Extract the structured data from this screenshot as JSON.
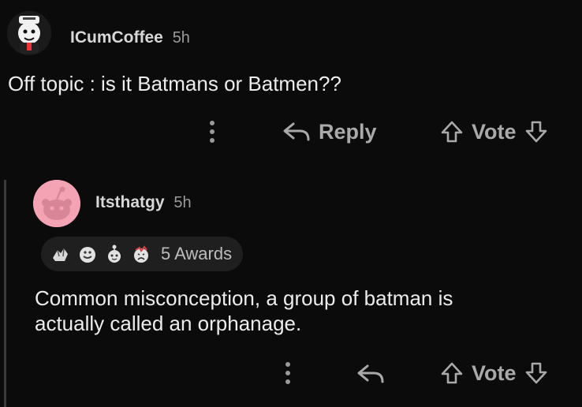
{
  "comment": {
    "author": "ICumCoffee",
    "time": "5h",
    "text": "Off topic : is it Batmans or Batmen??",
    "actions": {
      "reply_label": "Reply",
      "vote_label": "Vote"
    }
  },
  "reply": {
    "author": "Itsthatgy",
    "time": "5h",
    "awards_label": "5 Awards",
    "text_line1": "Common misconception, a group of batman is",
    "text_line2": "actually called an orphanage.",
    "actions": {
      "vote_label": "Vote"
    }
  },
  "colors": {
    "background": "#0b0b0b",
    "reply_avatar": "#f4a3b4",
    "muted": "#a9a9a9"
  },
  "icons": [
    "avatar",
    "more-icon",
    "reply-arrow-icon",
    "upvote-icon",
    "downvote-icon",
    "award-icons"
  ]
}
